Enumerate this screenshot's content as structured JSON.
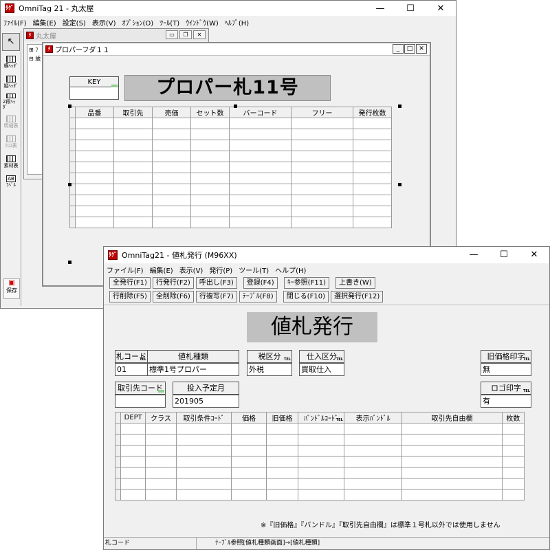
{
  "back": {
    "title": "OmniTag 21 - 丸太屋",
    "controls": [
      "—",
      "☐",
      "✕"
    ],
    "menu": [
      "ﾌｧｲﾙ(F)",
      "編集(E)",
      "設定(S)",
      "表示(V)",
      "ｵﾌﾟｼｮﾝ(O)",
      "ﾂｰﾙ(T)",
      "ｳｲﾝﾄﾞｳ(W)",
      "ﾍﾙﾌﾟ(H)"
    ],
    "tools": [
      {
        "label": "",
        "name": "pointer"
      },
      {
        "label": "横ﾍｯﾀﾞ",
        "name": "horizontal-header"
      },
      {
        "label": "縦ﾍｯﾀﾞ",
        "name": "vertical-header"
      },
      {
        "label": "2段ﾍｯﾀﾞ",
        "name": "two-tier-header"
      },
      {
        "label": "明細表",
        "name": "detail-table"
      },
      {
        "label": "ｸﾛｽ表",
        "name": "cross-table"
      },
      {
        "label": "素材表",
        "name": "material-table"
      },
      {
        "label": "ﾗﾍﾞﾙ",
        "name": "label"
      }
    ],
    "save_label": "保存",
    "maru_title": "丸太屋",
    "tree_items": [
      "⊞ ﾌ",
      "⊟ 歳"
    ],
    "proper_title": "プロパーフダ１１",
    "key_label": "KEY",
    "big_title": "プロパー札11号",
    "columns": [
      "品番",
      "取引先",
      "売価",
      "セット数",
      "バーコード",
      "フリー",
      "発行枚数"
    ]
  },
  "front": {
    "title": "OmniTag21 -        値札発行 (M96XX)",
    "controls": [
      "—",
      "☐",
      "✕"
    ],
    "menu": [
      "ファイル(F)",
      "編集(E)",
      "表示(V)",
      "発行(P)",
      "ツール(T)",
      "ヘルプ(H)"
    ],
    "toolbar1": [
      "全発行(F1)",
      "行発行(F2)",
      "呼出し(F3)",
      "登録(F4)",
      "ｷｰ参照(F11)",
      "上書き(W)"
    ],
    "toolbar2": [
      "行削除(F5)",
      "全削除(F6)",
      "行複写(F7)",
      "ﾃｰﾌﾞﾙ(F8)",
      "閉じる(F10)",
      "選択発行(F12)"
    ],
    "header_title": "値札発行",
    "fields": {
      "tag_code_label": "札コード",
      "tag_code_value": "01",
      "tag_type_label": "値札種類",
      "tag_type_value": "標準1号プロパー",
      "tax_label": "税区分",
      "tax_value": "外税",
      "purchase_label": "仕入区分",
      "purchase_value": "買取仕入",
      "old_price_label": "旧価格印字",
      "old_price_value": "無",
      "customer_label": "取引先コード",
      "customer_value": "",
      "planned_label": "投入予定月",
      "planned_value": "201905",
      "logo_label": "ロゴ印字",
      "logo_value": "有"
    },
    "columns": [
      "DEPT",
      "クラス",
      "取引条件ｺｰﾄﾞ",
      "価格",
      "旧価格",
      "ﾊﾞﾝﾄﾞﾙｺｰﾄﾞ",
      "表示ﾊﾞﾝﾄﾞﾙ",
      "取引先自由欄",
      "枚数"
    ],
    "note": "※『旧価格』『バンドル』『取引先自由欄』は標準１号札以外では使用しません",
    "status_left": "札コード",
    "status_mid": "ﾃｰﾌﾞﾙ参照[値札種類画面]→[値札種類]",
    "tel_mark": "TEL"
  }
}
